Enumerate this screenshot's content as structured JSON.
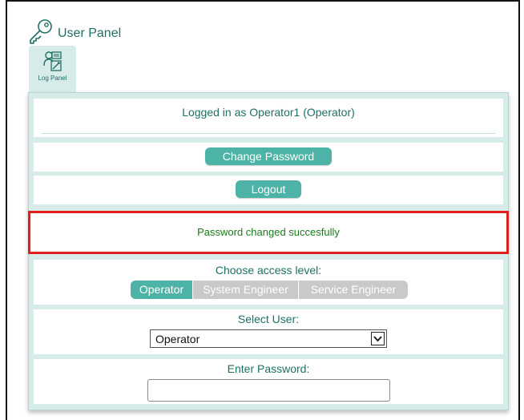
{
  "header": {
    "title": "User Panel",
    "icon": "key-icon"
  },
  "tab": {
    "label": "Log Panel",
    "icon": "user-panel-icon"
  },
  "status": {
    "logged_in": "Logged in as Operator1 (Operator)"
  },
  "buttons": {
    "change_password": "Change Password",
    "logout": "Logout"
  },
  "message": {
    "text": "Password changed succesfully"
  },
  "access": {
    "label": "Choose access level:",
    "options": [
      "Operator",
      "System Engineer",
      "Service Engineer"
    ],
    "selected": "Operator"
  },
  "user_select": {
    "label": "Select User:",
    "value": "Operator"
  },
  "password": {
    "label": "Enter Password:",
    "value": ""
  },
  "colors": {
    "accent": "#4db3a6",
    "panel_bg": "#d7ebe8",
    "text_teal": "#1f6f66",
    "success_text": "#1b7a1b",
    "highlight_border": "#e11f1f",
    "inactive_segment": "#c9c9c9"
  }
}
